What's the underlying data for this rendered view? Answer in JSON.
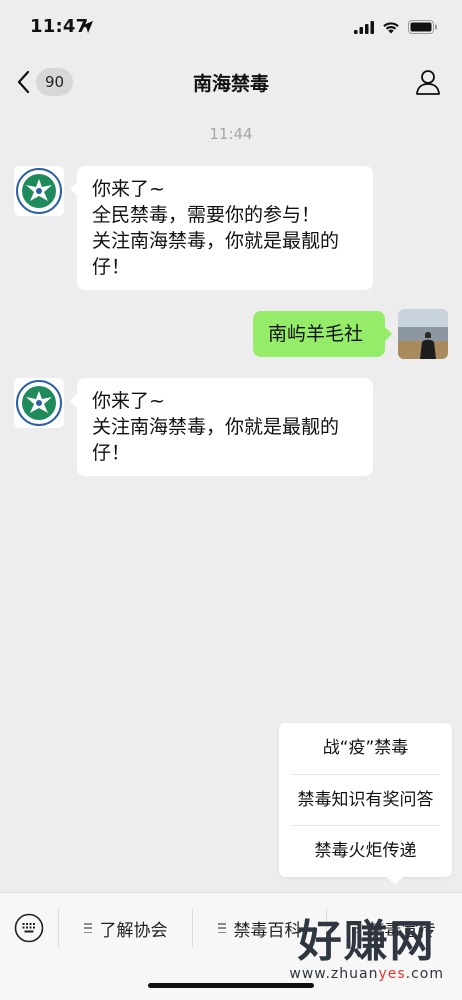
{
  "status_bar": {
    "time": "11:47"
  },
  "nav": {
    "unread_count": "90",
    "title": "南海禁毒"
  },
  "chat": {
    "timestamp": "11:44",
    "messages": [
      {
        "from": "official",
        "text": "你来了~\n全民禁毒，需要你的参与！\n关注南海禁毒，你就是最靓的\n仔！"
      },
      {
        "from": "me",
        "text": "南屿羊毛社"
      },
      {
        "from": "official",
        "text": "你来了~\n关注南海禁毒，你就是最靓的\n仔！"
      }
    ]
  },
  "popup_menu": {
    "items": [
      "战“疫”禁毒",
      "禁毒知识有奖问答",
      "禁毒火炬传递"
    ]
  },
  "bottom_menu": {
    "items": [
      "了解协会",
      "禁毒百科",
      "禁毒宣传"
    ]
  },
  "watermark": {
    "main": "好赚网",
    "sub_prefix": "www.zhuan",
    "sub_highlight": "yes",
    "sub_suffix": ".com"
  },
  "colors": {
    "background": "#ededed",
    "my_bubble": "#95ec69",
    "bubble": "#ffffff",
    "logo_green": "#1f8a5b",
    "logo_blue": "#2b5fa8"
  }
}
